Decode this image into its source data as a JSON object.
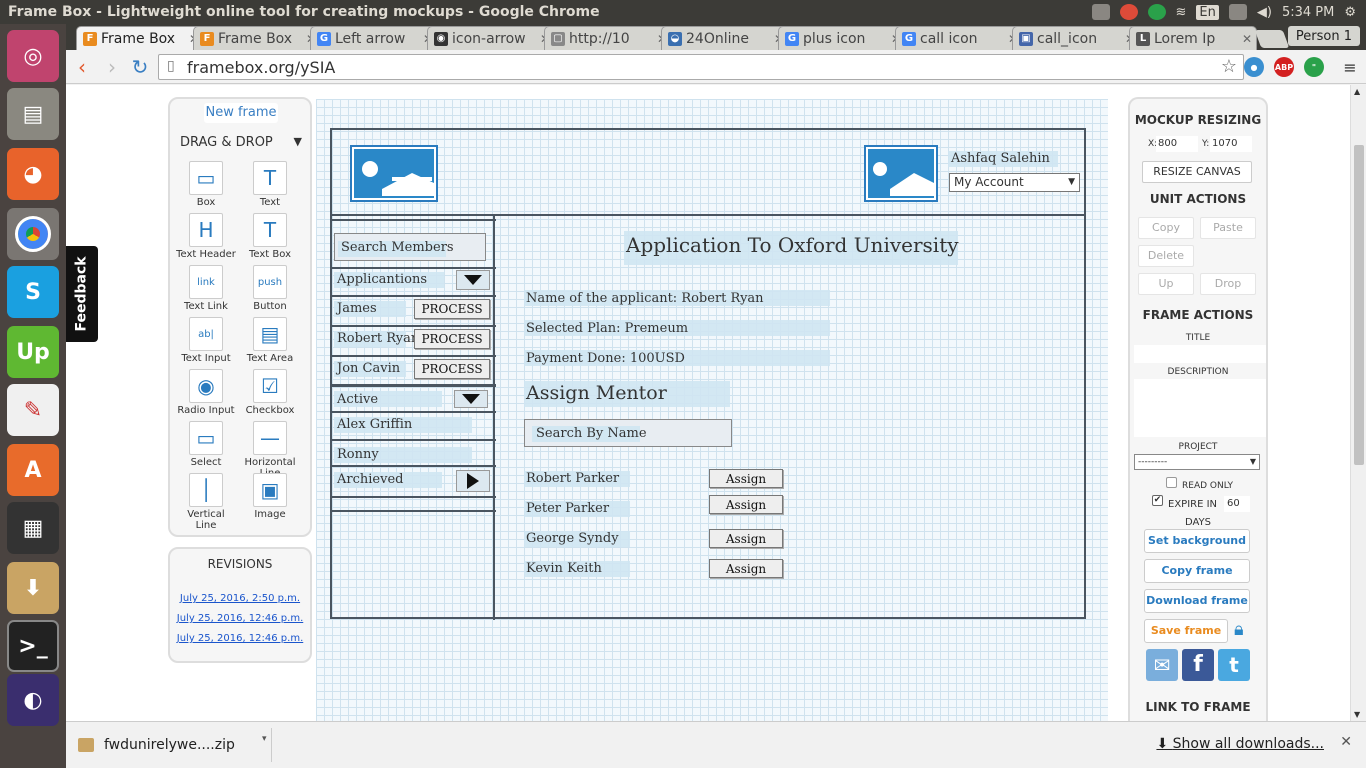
{
  "window": {
    "title": "Frame Box - Lightweight online tool for creating mockups - Google Chrome"
  },
  "tray": {
    "kbd": "En",
    "time": "5:34 PM"
  },
  "tabs": [
    {
      "label": "Frame Box",
      "fav": "F",
      "color": "#e98b1f"
    },
    {
      "label": "Frame Box",
      "fav": "F",
      "color": "#e98b1f"
    },
    {
      "label": "Left arrow",
      "fav": "G",
      "color": "#4285f4"
    },
    {
      "label": "icon-arrow",
      "fav": "◉",
      "color": "#333333"
    },
    {
      "label": "http://10",
      "fav": "▢",
      "color": "#888888"
    },
    {
      "label": "24Online",
      "fav": "◒",
      "color": "#3a6fb0"
    },
    {
      "label": "plus icon",
      "fav": "G",
      "color": "#4285f4"
    },
    {
      "label": "call icon",
      "fav": "G",
      "color": "#4285f4"
    },
    {
      "label": "call_icon",
      "fav": "▣",
      "color": "#4466aa"
    },
    {
      "label": "Lorem Ip",
      "fav": "L",
      "color": "#555555"
    }
  ],
  "person": "Person 1",
  "url": "framebox.org/ySIA",
  "feedback": "Feedback",
  "left_panel": {
    "new_frame": "New frame",
    "drag_drop": "DRAG & DROP",
    "tools": [
      {
        "label": "Box",
        "glyph": "▭"
      },
      {
        "label": "Text",
        "glyph": "T"
      },
      {
        "label": "Text Header",
        "glyph": "H"
      },
      {
        "label": "Text Box",
        "glyph": "T"
      },
      {
        "label": "Text Link",
        "glyph": "link"
      },
      {
        "label": "Button",
        "glyph": "push"
      },
      {
        "label": "Text Input",
        "glyph": "ab|"
      },
      {
        "label": "Text Area",
        "glyph": "▤"
      },
      {
        "label": "Radio Input",
        "glyph": "◉"
      },
      {
        "label": "Checkbox",
        "glyph": "☑"
      },
      {
        "label": "Select",
        "glyph": "▭"
      },
      {
        "label": "Horizontal Line",
        "glyph": "—"
      },
      {
        "label": "Vertical Line",
        "glyph": "│"
      },
      {
        "label": "Image",
        "glyph": "▣"
      }
    ],
    "revisions_title": "REVISIONS",
    "revisions": [
      "July 25, 2016, 2:50 p.m.",
      "July 25, 2016, 12:46 p.m.",
      "July 25, 2016, 12:46 p.m."
    ]
  },
  "mockup": {
    "user_name": "Ashfaq Salehin",
    "account_select": "My Account",
    "search_members": "Search Members",
    "applications": "Applicantions",
    "applicants": [
      {
        "name": "James",
        "action": "PROCESS"
      },
      {
        "name": "Robert Ryan",
        "action": "PROCESS"
      },
      {
        "name": "Jon Cavin",
        "action": "PROCESS"
      }
    ],
    "active": "Active",
    "active_items": [
      "Alex Griffin",
      "Ronny"
    ],
    "achieved": "Archieved",
    "heading": "Application To Oxford University",
    "details": [
      "Name of the applicant: Robert Ryan",
      "Selected Plan: Premeum",
      "Payment Done: 100USD"
    ],
    "assign_heading": "Assign Mentor",
    "search_by_name": "Search By Name",
    "mentors": [
      {
        "name": "Robert Parker",
        "action": "Assign"
      },
      {
        "name": "Peter Parker",
        "action": "Assign"
      },
      {
        "name": "George Syndy",
        "action": "Assign"
      },
      {
        "name": "Kevin Keith",
        "action": "Assign"
      }
    ]
  },
  "right_panel": {
    "resizing_title": "MOCKUP RESIZING",
    "x_label": "X:",
    "x_value": "800",
    "y_label": "Y:",
    "y_value": "1070",
    "resize_canvas": "RESIZE CANVAS",
    "unit_actions": "UNIT ACTIONS",
    "copy": "Copy",
    "paste": "Paste",
    "delete": "Delete",
    "up": "Up",
    "drop": "Drop",
    "frame_actions": "FRAME ACTIONS",
    "title_label": "TITLE",
    "description_label": "DESCRIPTION",
    "project_label": "PROJECT",
    "project_value": "---------",
    "read_only": "READ ONLY",
    "expire_in": "EXPIRE IN",
    "expire_value": "60",
    "days": "DAYS",
    "set_background": "Set background",
    "copy_frame": "Copy frame",
    "download_frame": "Download frame",
    "save_frame": "Save frame",
    "link_to_frame": "LINK TO FRAME"
  },
  "downloads": {
    "file": "fwdunirelywe....zip",
    "show_all": "Show all downloads..."
  }
}
